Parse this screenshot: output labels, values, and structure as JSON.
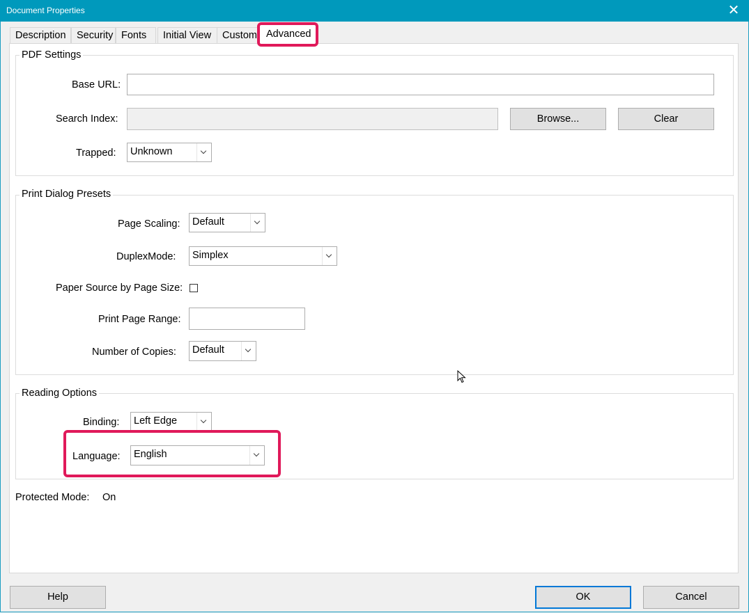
{
  "window": {
    "title": "Document Properties",
    "close_glyph": "✕"
  },
  "tabs": [
    {
      "label": "Description"
    },
    {
      "label": "Security"
    },
    {
      "label": "Fonts"
    },
    {
      "label": "Initial View"
    },
    {
      "label": "Custom"
    },
    {
      "label": "Advanced",
      "active": true
    }
  ],
  "pdf_settings": {
    "title": "PDF Settings",
    "base_url": {
      "label": "Base URL:",
      "value": ""
    },
    "search_index": {
      "label": "Search Index:",
      "value": "",
      "browse_label": "Browse...",
      "clear_label": "Clear"
    },
    "trapped": {
      "label": "Trapped:",
      "value": "Unknown"
    }
  },
  "print_presets": {
    "title": "Print Dialog Presets",
    "page_scaling": {
      "label": "Page Scaling:",
      "value": "Default"
    },
    "duplex_mode": {
      "label": "DuplexMode:",
      "value": "Simplex"
    },
    "paper_source": {
      "label": "Paper Source by Page Size:",
      "checked": false
    },
    "print_page_range": {
      "label": "Print Page Range:",
      "value": ""
    },
    "number_of_copies": {
      "label": "Number of Copies:",
      "value": "Default"
    }
  },
  "reading_options": {
    "title": "Reading Options",
    "binding": {
      "label": "Binding:",
      "value": "Left Edge"
    },
    "language": {
      "label": "Language:",
      "value": "English"
    }
  },
  "protected_mode": {
    "label": "Protected Mode:",
    "value": "On"
  },
  "footer": {
    "help_label": "Help",
    "ok_label": "OK",
    "cancel_label": "Cancel"
  },
  "colors": {
    "titlebar": "#0099bc",
    "highlight": "#e0195a",
    "default_button_border": "#0078d7"
  }
}
